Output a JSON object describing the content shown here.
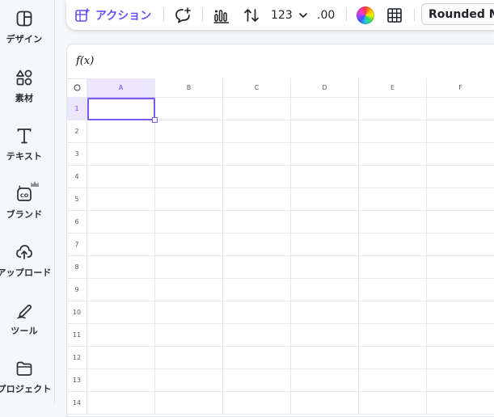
{
  "sidebar": {
    "items": [
      {
        "label": "デザイン",
        "icon": "design-icon"
      },
      {
        "label": "素材",
        "icon": "elements-icon"
      },
      {
        "label": "テキスト",
        "icon": "text-icon"
      },
      {
        "label": "ブランド",
        "icon": "brand-icon"
      },
      {
        "label": "アップロード",
        "icon": "upload-icon"
      },
      {
        "label": "ツール",
        "icon": "tools-icon"
      },
      {
        "label": "プロジェクト",
        "icon": "projects-icon"
      }
    ]
  },
  "toolbar": {
    "action_label": "アクション",
    "number_format": "123",
    "decimal_label": ".00",
    "font_name": "Rounded M+",
    "accent_color": "#6a4df4"
  },
  "formula_bar": {
    "fx_label": "f(x)",
    "value": ""
  },
  "sheet": {
    "columns": [
      "A",
      "B",
      "C",
      "D",
      "E",
      "F"
    ],
    "rows": [
      "1",
      "2",
      "3",
      "4",
      "5",
      "6",
      "7",
      "8",
      "9",
      "10",
      "11",
      "12",
      "13",
      "14"
    ],
    "selected_cell": "A1"
  }
}
